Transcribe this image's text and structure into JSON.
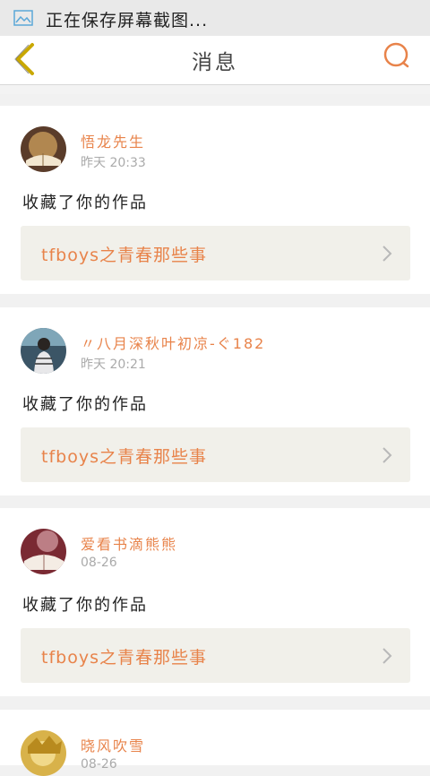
{
  "statusbar": {
    "icon": "image-icon",
    "text": "正在保存屏幕截图..."
  },
  "navbar": {
    "back_icon": "chevron-left-icon",
    "title": "消息",
    "search_icon": "search-icon"
  },
  "colors": {
    "accent": "#e8834a",
    "back": "#c9a800",
    "card_bg": "#ffffff",
    "work_bg": "#f1f0ea"
  },
  "messages": [
    {
      "name": "悟龙先生",
      "time": "昨天 20:33",
      "action": "收藏了你的作品",
      "work": "tfboys之青春那些事"
    },
    {
      "name": "〃八月深秋叶初凉-ぐ182",
      "time": "昨天 20:21",
      "action": "收藏了你的作品",
      "work": "tfboys之青春那些事"
    },
    {
      "name": "爱看书滴熊熊",
      "time": "08-26",
      "action": "收藏了你的作品",
      "work": "tfboys之青春那些事"
    },
    {
      "name": "晓风吹雪",
      "time": "08-26",
      "action": "",
      "work": ""
    }
  ]
}
